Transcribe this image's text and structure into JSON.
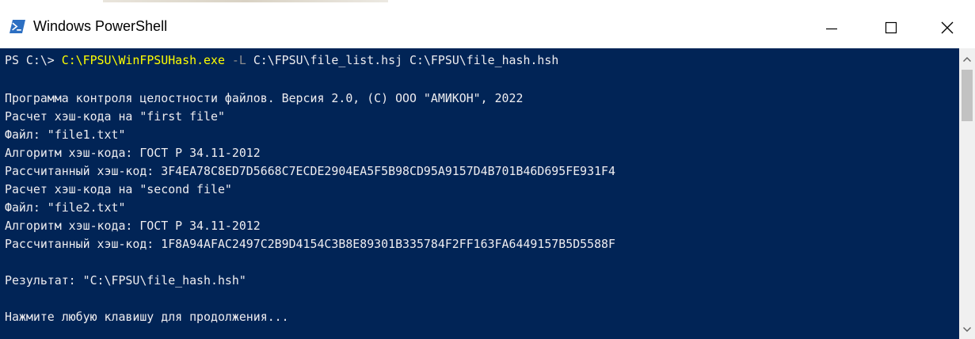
{
  "window": {
    "title": "Windows PowerShell",
    "icon": "powershell-icon"
  },
  "controls": {
    "minimize_icon": "minimize-icon",
    "maximize_icon": "maximize-icon",
    "close_icon": "close-icon"
  },
  "colors": {
    "console_background": "#012456",
    "console_text": "#eeedf0",
    "command_text": "#ffff00",
    "parameter_text": "#8e8e8e"
  },
  "console": {
    "command": {
      "prompt": "PS C:\\> ",
      "executable": "C:\\FPSU\\WinFPSUHash.exe",
      "parameter": "-L",
      "arguments": "C:\\FPSU\\file_list.hsj C:\\FPSU\\file_hash.hsh"
    },
    "output_lines": [
      "Программа контроля целостности файлов. Версия 2.0, (C) ООО \"АМИКОН\", 2022",
      "Расчет хэш-кода на \"first file\"",
      "Файл: \"file1.txt\"",
      "Алгоритм хэш-кода: ГОСТ Р 34.11-2012",
      "Рассчитанный хэш-код: 3F4EA78C8ED7D5668C7ECDE2904EA5F5B98CD95A9157D4B701B46D695FE931F4",
      "Расчет хэш-кода на \"second file\"",
      "Файл: \"file2.txt\"",
      "Алгоритм хэш-кода: ГОСТ Р 34.11-2012",
      "Рассчитанный хэш-код: 1F8A94AFAC2497C2B9D4154C3B8E89301B335784F2FF163FA6449157B5D5588F"
    ],
    "result_line": "Результат: \"C:\\FPSU\\file_hash.hsh\"",
    "prompt_line": "Нажмите любую клавишу для продолжения..."
  },
  "scrollbar": {
    "up_icon": "scroll-up-arrow-icon",
    "down_icon": "scroll-down-arrow-icon",
    "position": 0
  }
}
